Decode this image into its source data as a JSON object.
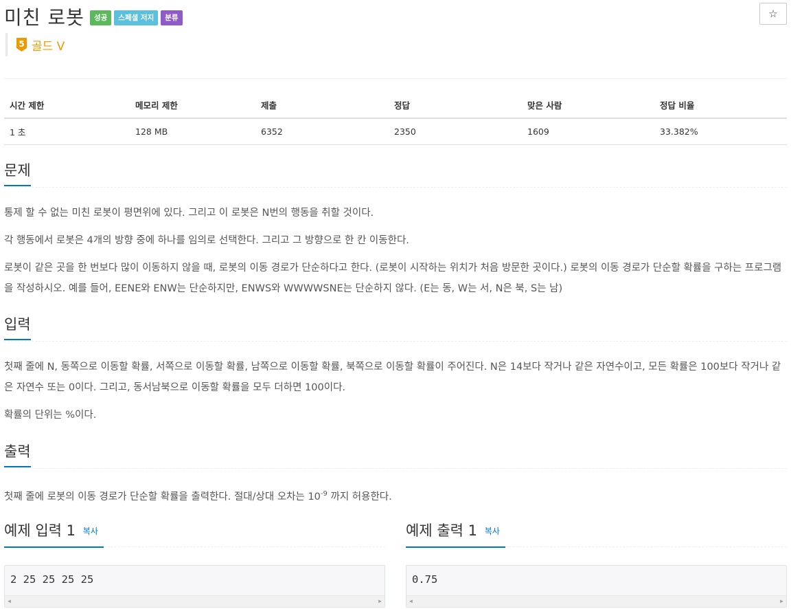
{
  "problem": {
    "title": "미친 로봇",
    "badges": [
      "성공",
      "스페셜 저지",
      "분류"
    ],
    "tier": "골드 V",
    "tier_number": "5",
    "star": "☆"
  },
  "info_table": {
    "headers": [
      "시간 제한",
      "메모리 제한",
      "제출",
      "정답",
      "맞은 사람",
      "정답 비율"
    ],
    "values": [
      "1 초",
      "128 MB",
      "6352",
      "2350",
      "1609",
      "33.382%"
    ]
  },
  "sections": {
    "problem": {
      "title": "문제",
      "paragraphs": [
        "통제 할 수 없는 미친 로봇이 평면위에 있다. 그리고 이 로봇은 N번의 행동을 취할 것이다.",
        "각 행동에서 로봇은 4개의 방향 중에 하나를 임의로 선택한다. 그리고 그 방향으로 한 칸 이동한다.",
        "로봇이 같은 곳을 한 번보다 많이 이동하지 않을 때, 로봇의 이동 경로가 단순하다고 한다. (로봇이 시작하는 위치가 처음 방문한 곳이다.) 로봇의 이동 경로가 단순할 확률을 구하는 프로그램을 작성하시오. 예를 들어, EENE와 ENW는 단순하지만, ENWS와 WWWWSNE는 단순하지 않다. (E는 동, W는 서, N은 북, S는 남)"
      ]
    },
    "input": {
      "title": "입력",
      "paragraphs": [
        "첫째 줄에 N, 동쪽으로 이동할 확률, 서쪽으로 이동할 확률, 남쪽으로 이동할 확률, 북쪽으로 이동할 확률이 주어진다. N은 14보다 작거나 같은 자연수이고,  모든 확률은 100보다 작거나 같은 자연수 또는 0이다. 그리고, 동서남북으로 이동할 확률을 모두 더하면 100이다.",
        "확률의 단위는 %이다."
      ]
    },
    "output": {
      "title": "출력",
      "text_before": "첫째 줄에 로봇의 이동 경로가 단순할 확률을 출력한다. 절대/상대 오차는 10",
      "superscript": "-9",
      "text_after": " 까지 허용한다."
    }
  },
  "samples": {
    "input": {
      "title": "예제 입력 1",
      "copy": "복사",
      "content": "2 25 25 25 25"
    },
    "output": {
      "title": "예제 출력 1",
      "copy": "복사",
      "content": "0.75"
    }
  }
}
